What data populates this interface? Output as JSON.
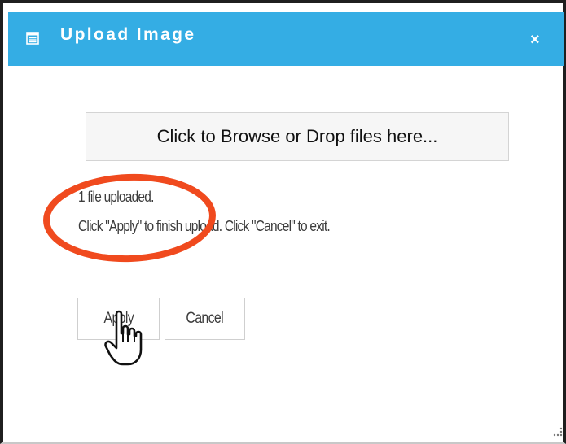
{
  "dialog": {
    "title": "Upload Image",
    "title_icon": "list-icon",
    "close_icon": "close-icon",
    "close_glyph": "×"
  },
  "upload": {
    "browse_label": "Click to Browse or Drop files here...",
    "status_count": "1 file uploaded.",
    "status_instructions": "Click \"Apply\" to finish upload. Click \"Cancel\" to exit."
  },
  "buttons": {
    "apply_label": "Apply",
    "cancel_label": "Cancel"
  },
  "annotation": {
    "highlight_color": "#f04a1e",
    "title_bar_color": "#34ade4"
  },
  "cursor": "hand-pointer-icon"
}
